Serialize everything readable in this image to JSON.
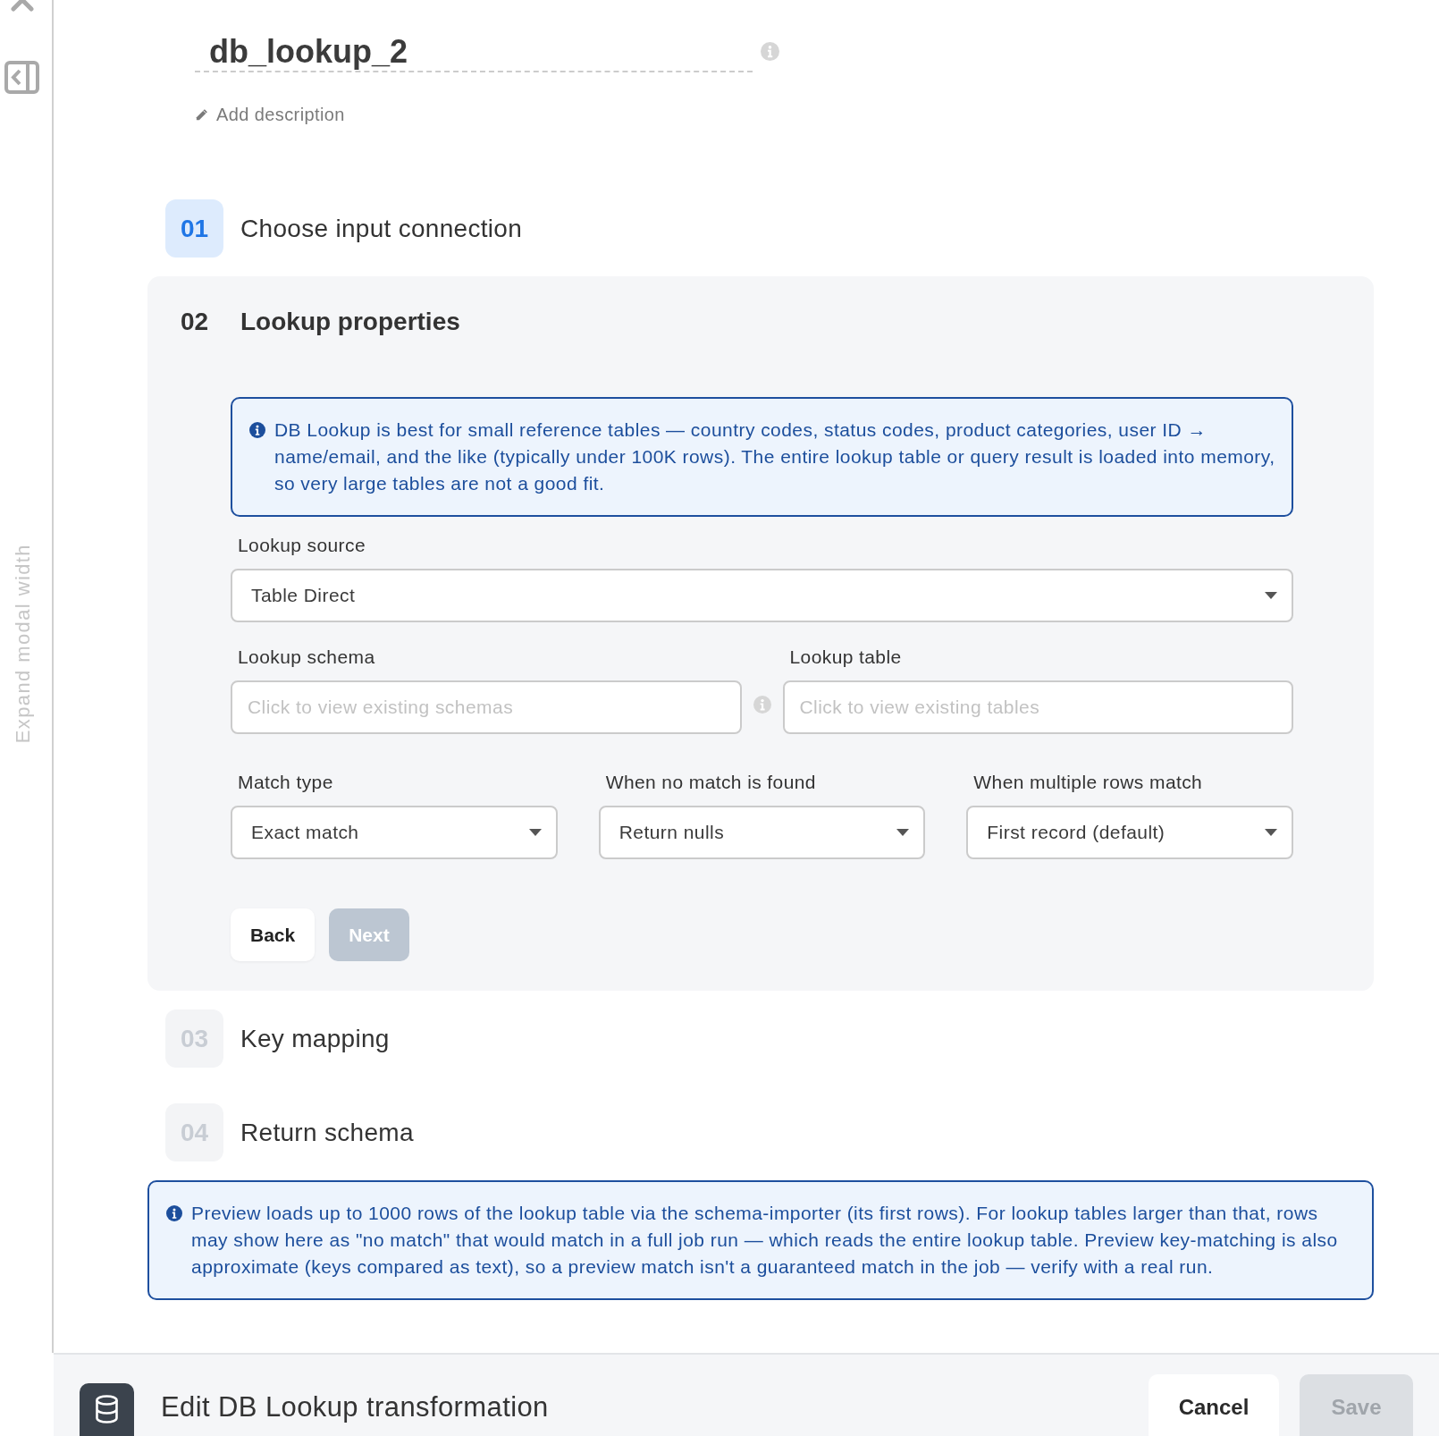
{
  "sidebar": {
    "expand_label": "Expand modal width"
  },
  "name": {
    "value": "db_lookup_2",
    "info_icon": true,
    "add_description": "Add description"
  },
  "steps": [
    {
      "number": "01",
      "title": "Choose input connection",
      "completed": true,
      "expanded": false
    },
    {
      "number": "02",
      "title": "Lookup properties",
      "completed": false,
      "expanded": true,
      "notice": "DB Lookup is best for small reference tables — country codes, status codes, product categories, user ID → name/email, and the like (typically under 100K rows). The entire lookup table or query result is loaded into memory, so very large tables are not a good fit.",
      "rows": [
        [
          {
            "kind": "select",
            "label": "Lookup source",
            "value": "Table Direct"
          }
        ],
        [
          {
            "kind": "input",
            "label": "Lookup schema",
            "placeholder": "Click to view existing schemas",
            "info_icon": true
          },
          {
            "kind": "input",
            "label": "Lookup table",
            "placeholder": "Click to view existing tables"
          }
        ],
        [
          {
            "kind": "select",
            "label": "Match type",
            "value": "Exact match"
          },
          {
            "kind": "select",
            "label": "When no match is found",
            "value": "Return nulls"
          },
          {
            "kind": "select",
            "label": "When multiple rows match",
            "value": "First record (default)"
          }
        ]
      ],
      "buttons": [
        {
          "label": "Back",
          "disabled": false
        },
        {
          "label": "Next",
          "disabled": true
        }
      ]
    },
    {
      "number": "03",
      "title": "Key mapping",
      "completed": false,
      "expanded": false
    },
    {
      "number": "04",
      "title": "Return schema",
      "completed": false,
      "expanded": false
    }
  ],
  "preview_notice": "Preview loads up to 1000 rows of the lookup table via the schema-importer (its first rows). For lookup tables larger than that, rows may show here as \"no match\" that would match in a full job run — which reads the entire lookup table. Preview key-matching is also approximate (keys compared as text), so a preview match isn't a guaranteed match in the job — verify with a real run.",
  "footer": {
    "title": "Edit DB Lookup transformation",
    "buttons": [
      {
        "label": "Cancel",
        "disabled": false
      },
      {
        "label": "Save",
        "disabled": true
      }
    ]
  }
}
